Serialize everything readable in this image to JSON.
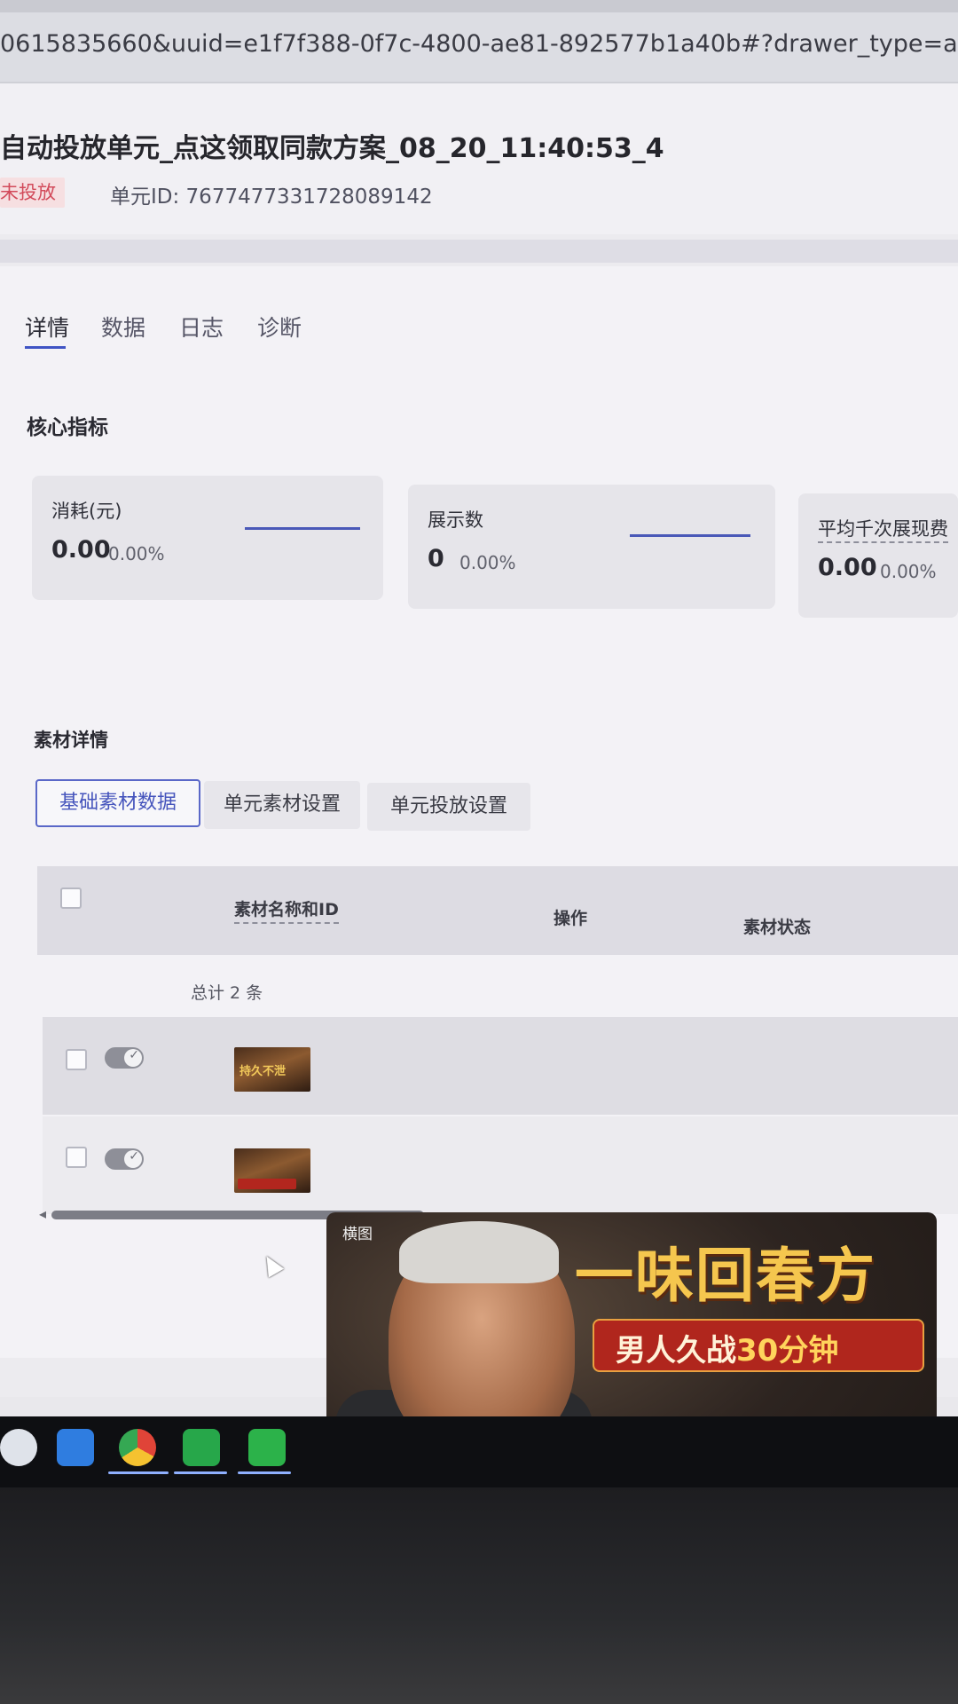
{
  "browser": {
    "url": "0615835660&uuid=e1f7f388-0f7c-4800-ae81-892577b1a40b#?drawer_type=ad&drawer_ta"
  },
  "header": {
    "title": "自动投放单元_点这领取同款方案_08_20_11:40:53_4",
    "status": "未投放",
    "unit_id": "单元ID: 7677477331728089142"
  },
  "tabs": [
    {
      "label": "详情"
    },
    {
      "label": "数据"
    },
    {
      "label": "日志"
    },
    {
      "label": "诊断"
    }
  ],
  "core_metrics": {
    "title": "核心指标",
    "items": [
      {
        "label": "消耗(元)",
        "value": "0.00",
        "pct": "0.00%"
      },
      {
        "label": "展示数",
        "value": "0",
        "pct": "0.00%"
      },
      {
        "label": "平均千次展现费",
        "value": "0.00",
        "pct": "0.00%"
      }
    ]
  },
  "materials": {
    "title": "素材详情",
    "subtabs": [
      {
        "label": "基础素材数据"
      },
      {
        "label": "单元素材设置"
      },
      {
        "label": "单元投放设置"
      }
    ],
    "columns": [
      "素材名称和ID",
      "操作",
      "素材状态"
    ],
    "total": "总计 2 条",
    "rows": [
      {
        "enabled": true
      },
      {
        "enabled": true
      }
    ],
    "footer_count": "2 条"
  },
  "preview": {
    "badge": "横图",
    "headline": "一味回春方",
    "banner_prefix": "男人久战",
    "banner_highlight": "30分钟",
    "big_text": "持久不泄"
  },
  "icons": {
    "check": "✓",
    "scroll_left": "◂"
  }
}
